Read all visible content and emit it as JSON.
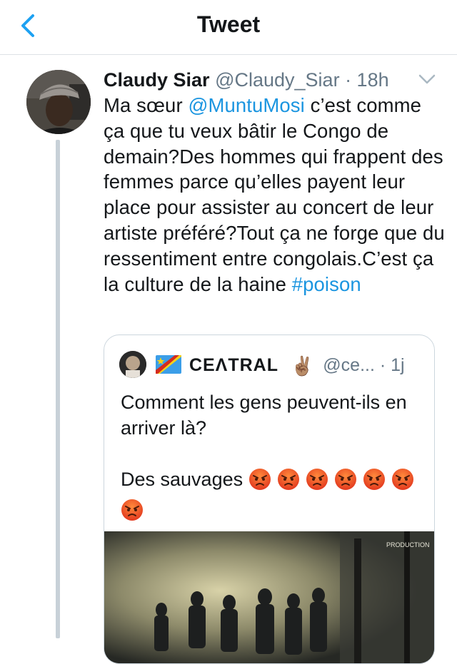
{
  "nav": {
    "back_icon": "chevron-left-icon",
    "title": "Tweet"
  },
  "tweet": {
    "author_name": "Claudy Siar",
    "author_meta": "@Claudy_Siar · 18h",
    "caret_icon": "chevron-down-icon",
    "text_parts": {
      "p1": "Ma sœur ",
      "mention": "@MuntuMosi",
      "p2": " c’est comme ça que tu veux bâtir le Congo de demain?Des hommes qui frappent des femmes parce qu’elles payent leur place pour assister au concert de leur artiste préféré?Tout ça ne forge que du ressentiment entre congolais.C’est ça la culture de la haine ",
      "hashtag": "#poison"
    }
  },
  "quote": {
    "author_name": "CEɅTRAL",
    "author_meta": "@ce... · 1j",
    "line1": "Comment les gens peuvent-ils en arriver là?",
    "line2": "Des sauvages",
    "angry_emoji_count": 7,
    "media_caption": "PRODUCTION"
  },
  "colors": {
    "link": "#1b95e0",
    "muted": "#657786",
    "border": "#ccd6dd",
    "thread": "#c8d1d8"
  }
}
